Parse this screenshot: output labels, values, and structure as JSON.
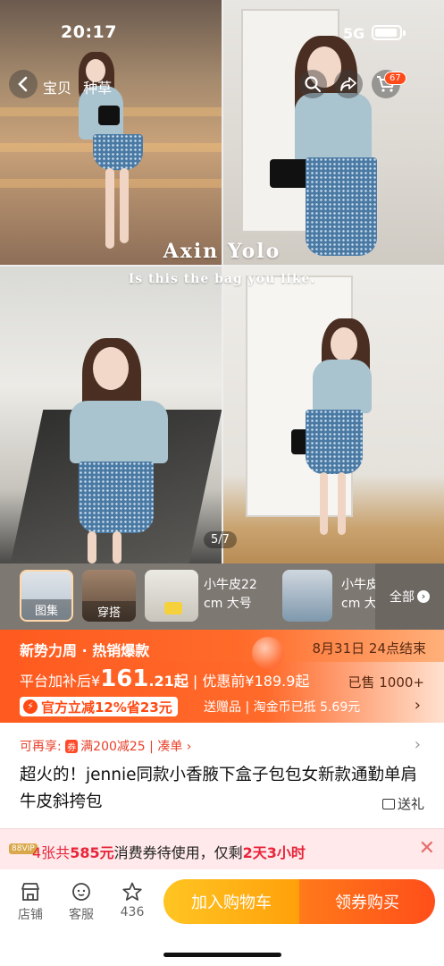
{
  "status_bar": {
    "time": "20:17",
    "network": "5G"
  },
  "nav": {
    "tabs": [
      "宝贝",
      "种草"
    ],
    "cart_badge": "67"
  },
  "gallery": {
    "watermark_title": "Axin Yolo",
    "watermark_subtitle": "Is this the bag you like.",
    "counter": "5/7"
  },
  "thumbs": {
    "items": [
      {
        "label": "图集"
      },
      {
        "label": "穿搭"
      },
      {
        "label": "小牛皮22cm大号"
      },
      {
        "label": "小牛皮cm大"
      }
    ],
    "t3_line1": "小牛皮22",
    "t3_line2": "cm 大号",
    "t4_line1": "小牛皮",
    "t4_line2": "cm 大",
    "all_label": "全部"
  },
  "promo": {
    "title": "新势力周 · 热销爆款",
    "end_time": "8月31日 24点结束",
    "price_prefix": "平台加补后¥",
    "price_int": "161",
    "price_dec": ".21起",
    "original_price": "优惠前¥189.9起",
    "sold": "已售 1000+",
    "coupon": "官方立减12%省23元",
    "gifts": "送赠品 | 淘金币已抵 5.69元"
  },
  "reuse": {
    "label": "可再享:",
    "deal": "满200减25",
    "action": "凑单"
  },
  "product": {
    "title": "超火的！jennie同款小香腋下盒子包包女新款通勤单肩牛皮斜挎包",
    "gift_label": "送礼"
  },
  "voucher_bar": {
    "tag": "88VIP",
    "count": "4张共",
    "amount": "585元",
    "text_mid": "消费券待使用，仅剩",
    "remaining": "2天3小时"
  },
  "bottom_bar": {
    "shop": "店铺",
    "service": "客服",
    "favorites": "436",
    "add_to_cart": "加入购物车",
    "buy": "领券购买"
  },
  "colors": {
    "accent": "#ff5a1f",
    "cart_button": "#ffb215",
    "buy_button": "#ff5e1a",
    "price_red": "#e8253a"
  }
}
